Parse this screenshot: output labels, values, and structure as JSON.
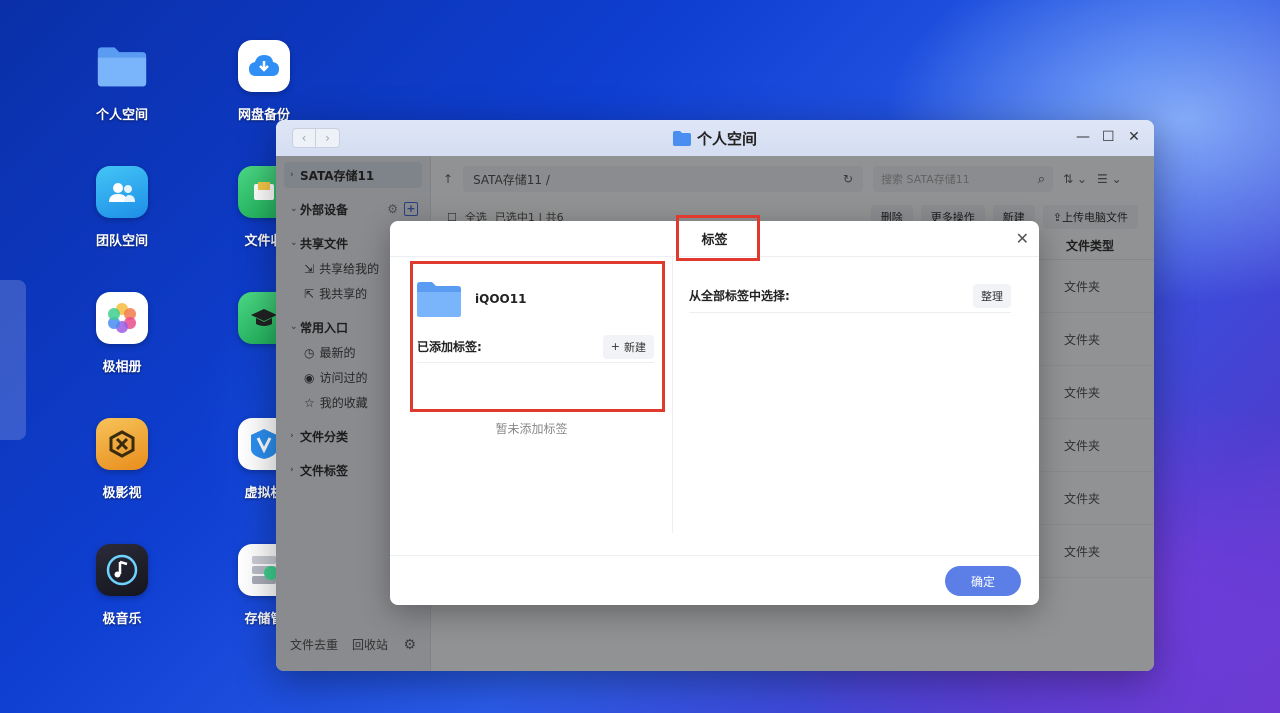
{
  "desktop": {
    "icons_col1": [
      {
        "label": "个人空间",
        "icon": "folder-icon"
      },
      {
        "label": "团队空间",
        "icon": "team-icon"
      },
      {
        "label": "极相册",
        "icon": "photos-icon"
      },
      {
        "label": "极影视",
        "icon": "video-icon"
      },
      {
        "label": "极音乐",
        "icon": "music-icon"
      }
    ],
    "icons_col2": [
      {
        "label": "网盘备份",
        "icon": "cloud-download-icon"
      },
      {
        "label": "文件收",
        "icon": "inbox-icon"
      },
      {
        "label": "",
        "icon": "graduation-cap-icon"
      },
      {
        "label": "虚拟机",
        "icon": "vm-icon"
      },
      {
        "label": "存储管",
        "icon": "storage-icon"
      }
    ]
  },
  "window": {
    "title": "个人空间",
    "sidebar": {
      "storage": "SATA存储11",
      "external": "外部设备",
      "shared": "共享文件",
      "shared_items": [
        "共享给我的",
        "我共享的"
      ],
      "common": "常用入口",
      "common_items": [
        "最新的",
        "访问过的",
        "我的收藏"
      ],
      "categories": "文件分类",
      "tags": "文件标签",
      "footer_dedupe": "文件去重",
      "footer_recycle": "回收站"
    },
    "toolbar": {
      "path": "SATA存储11 /",
      "search_placeholder": "搜索 SATA存储11"
    },
    "actions": {
      "select_all": "全选",
      "selection": "已选中1 | 共6",
      "delete": "删除",
      "more": "更多操作",
      "new": "新建",
      "upload": "上传电脑文件"
    },
    "list": {
      "col_type": "文件类型",
      "rows": [
        "文件夹",
        "文件夹",
        "文件夹",
        "文件夹",
        "文件夹",
        "文件夹"
      ]
    }
  },
  "dialog": {
    "title": "标签",
    "target_name": "iQOO11",
    "added_label": "已添加标签:",
    "new_button": "新建",
    "empty_note": "暂未添加标签",
    "all_label": "从全部标签中选择:",
    "organize_button": "整理",
    "ok_button": "确定"
  },
  "colors": {
    "accent": "#5b7fe6",
    "highlight": "#e03a2f"
  }
}
